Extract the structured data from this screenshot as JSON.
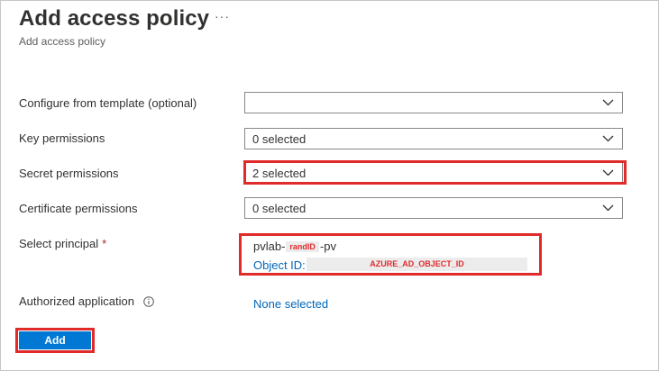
{
  "header": {
    "title": "Add access policy",
    "subtitle": "Add access policy",
    "more_label": "···"
  },
  "form": {
    "template": {
      "label": "Configure from template (optional)",
      "value": ""
    },
    "key_permissions": {
      "label": "Key permissions",
      "value": "0 selected"
    },
    "secret_permissions": {
      "label": "Secret permissions",
      "value": "2 selected"
    },
    "certificate_permissions": {
      "label": "Certificate permissions",
      "value": "0 selected"
    },
    "principal": {
      "label": "Select principal",
      "required_mark": "*",
      "name_prefix": "pvlab-",
      "name_tag": "randID",
      "name_suffix": "-pv",
      "object_id_label": "Object ID:",
      "object_id_value": "AZURE_AD_OBJECT_ID"
    },
    "authorized_application": {
      "label": "Authorized application",
      "value": "None selected"
    }
  },
  "actions": {
    "add_label": "Add"
  },
  "colors": {
    "accent": "#0078d4",
    "link": "#0066b8",
    "highlight": "#e02b2b",
    "required": "#a4262c"
  },
  "icons": [
    "chevron-down-icon",
    "info-icon",
    "more-icon"
  ]
}
